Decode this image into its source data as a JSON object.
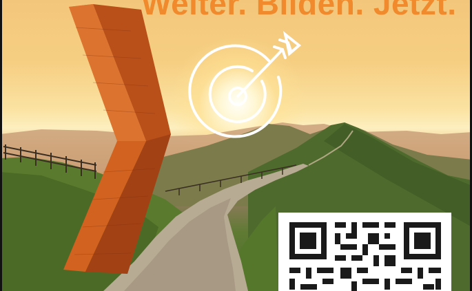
{
  "headline": {
    "text": "Weiter. Bilden. Jetzt."
  },
  "colors": {
    "headline": "#f08a2c",
    "arrow": "#c9571c",
    "arrow_shadow": "#8f3410",
    "target_stroke": "#ffffff",
    "qr_dark": "#1a1a1a",
    "qr_light": "#ffffff"
  },
  "icons": {
    "target": "target-with-arrow-icon",
    "chevron": "chevron-right-icon",
    "qr": "qr-code"
  }
}
